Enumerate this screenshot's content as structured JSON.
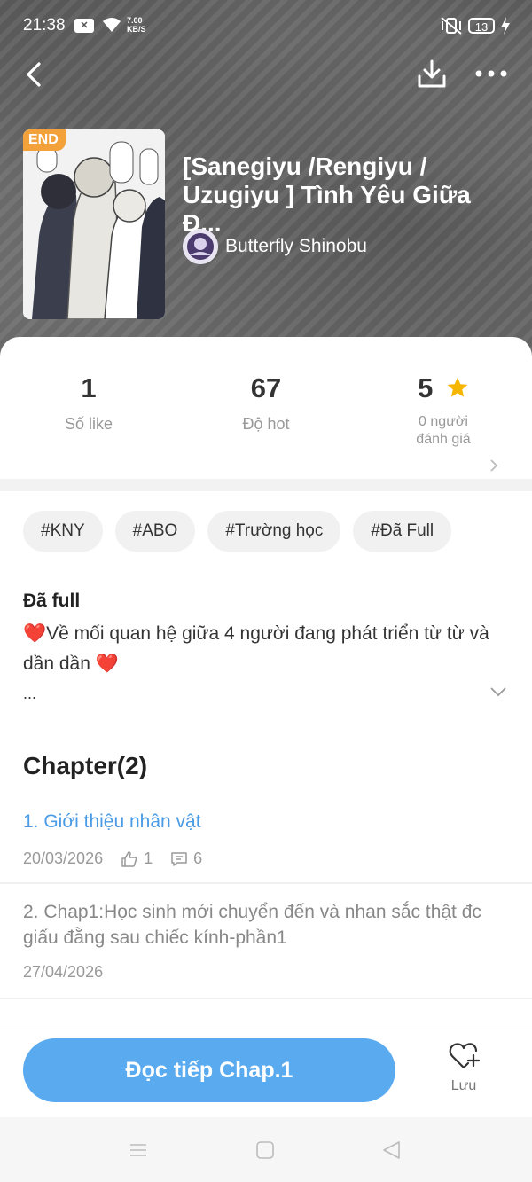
{
  "status_bar": {
    "time": "21:38",
    "net_speed_value": "7.00",
    "net_speed_unit": "KB/S",
    "battery": "13"
  },
  "book": {
    "badge": "END",
    "title": "[Sanegiyu /Rengiyu /\nUzugiyu ] Tình Yêu Giữa Đ...",
    "author": "Butterfly Shinobu"
  },
  "stats": {
    "likes_value": "1",
    "likes_label": "Số like",
    "hot_value": "67",
    "hot_label": "Độ hot",
    "rating_value": "5",
    "rating_label_line1": "0 người",
    "rating_label_line2": "đánh giá"
  },
  "tags": [
    "#KNY",
    "#ABO",
    "#Trường học",
    "#Đã Full"
  ],
  "description": {
    "status": "Đã full",
    "text": "❤️Về mối quan hệ giữa 4 người đang phát triển từ từ và dần dần ❤️",
    "more": "..."
  },
  "chapters": {
    "heading": "Chapter(2)",
    "items": [
      {
        "name": "1. Giới thiệu nhân vật",
        "date": "20/03/2026",
        "likes": "1",
        "comments": "6",
        "color": "#4a9be6"
      },
      {
        "name": "2. Chap1:Học sinh mới chuyển đến và nhan sắc thật đc giấu đằng sau chiếc kính-phần1",
        "date": "27/04/2026",
        "color": "#888888"
      }
    ]
  },
  "bottom": {
    "read_label": "Đọc tiếp Chap.1",
    "save_label": "Lưu"
  },
  "colors": {
    "accent": "#5aaaf0",
    "badge": "#f3a13a",
    "star": "#f6b600"
  }
}
